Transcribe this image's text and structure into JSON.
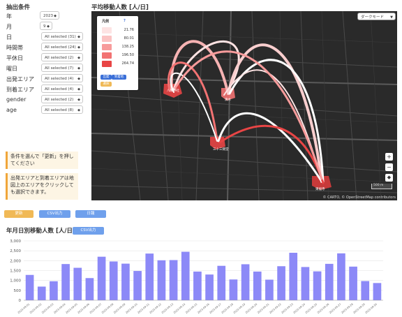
{
  "filters": {
    "title": "抽出条件",
    "rows": [
      {
        "label": "年",
        "value": "2023"
      },
      {
        "label": "月",
        "value": "9"
      },
      {
        "label": "日",
        "value": "All selected (31)"
      },
      {
        "label": "時間帯",
        "value": "All selected (24)"
      },
      {
        "label": "平休日",
        "value": "All selected (2)"
      },
      {
        "label": "曜日",
        "value": "All selected (7)"
      },
      {
        "label": "出発エリア",
        "value": "All selected (4)"
      },
      {
        "label": "到着エリア",
        "value": "All selected (4)"
      },
      {
        "label": "gender",
        "value": "All selected (2)"
      },
      {
        "label": "age",
        "value": "All selected (8)"
      }
    ]
  },
  "notes": {
    "note1": "条件を選んで「更新」を押してください",
    "note2": "出発エリアと到着エリアは地図上のエリアをクリックしても選択できます。"
  },
  "buttons": {
    "update": "更新",
    "csv": "CSV出力",
    "daily": "日報"
  },
  "map": {
    "title": "平均移動人数 [人/日]",
    "style_select": "ダークモード",
    "legend_title": "凡例",
    "legend_help": "?",
    "legend": [
      {
        "value": "21.76",
        "color": "#fde3e3"
      },
      {
        "value": "80.01",
        "color": "#fbc3c3"
      },
      {
        "value": "138.25",
        "color": "#f79b9b"
      },
      {
        "value": "196.50",
        "color": "#f27272"
      },
      {
        "value": "264.74",
        "color": "#e84545"
      }
    ],
    "chips": {
      "origin": "出発",
      "destination": "到着地",
      "selection": "選択"
    },
    "areas": [
      "八坂神社",
      "清水",
      "三十三間堂",
      "東福寺"
    ],
    "zoom_in": "+",
    "zoom_out": "−",
    "scale": "500 m",
    "attribution": "© CARTO, © OpenStreetMap contributors"
  },
  "chart_section": {
    "title": "年月日別移動人数 [人/日]",
    "csv_button": "CSV出力"
  },
  "chart_data": {
    "type": "bar",
    "title": "",
    "xlabel": "",
    "ylabel": "",
    "ylim": [
      0,
      3000
    ],
    "y_ticks": [
      "0",
      "500",
      "1,000",
      "1,500",
      "2,000",
      "2,500",
      "3,000"
    ],
    "color": "#8c89f7",
    "categories": [
      "2023-09-01",
      "2023-09-02",
      "2023-09-03",
      "2023-09-04",
      "2023-09-05",
      "2023-09-06",
      "2023-09-07",
      "2023-09-08",
      "2023-09-09",
      "2023-09-10",
      "2023-09-11",
      "2023-09-12",
      "2023-09-13",
      "2023-09-14",
      "2023-09-15",
      "2023-09-16",
      "2023-09-17",
      "2023-09-18",
      "2023-09-19",
      "2023-09-20",
      "2023-09-21",
      "2023-09-22",
      "2023-09-23",
      "2023-09-24",
      "2023-09-25",
      "2023-09-26",
      "2023-09-27",
      "2023-09-28",
      "2023-09-29",
      "2023-09-30"
    ],
    "values": [
      1280,
      690,
      960,
      1830,
      1640,
      1120,
      2200,
      1960,
      1850,
      1480,
      2360,
      2020,
      2030,
      2450,
      1450,
      1300,
      1740,
      1050,
      1820,
      1450,
      1040,
      1720,
      2400,
      1680,
      1460,
      1840,
      2370,
      1700,
      970,
      870
    ]
  }
}
